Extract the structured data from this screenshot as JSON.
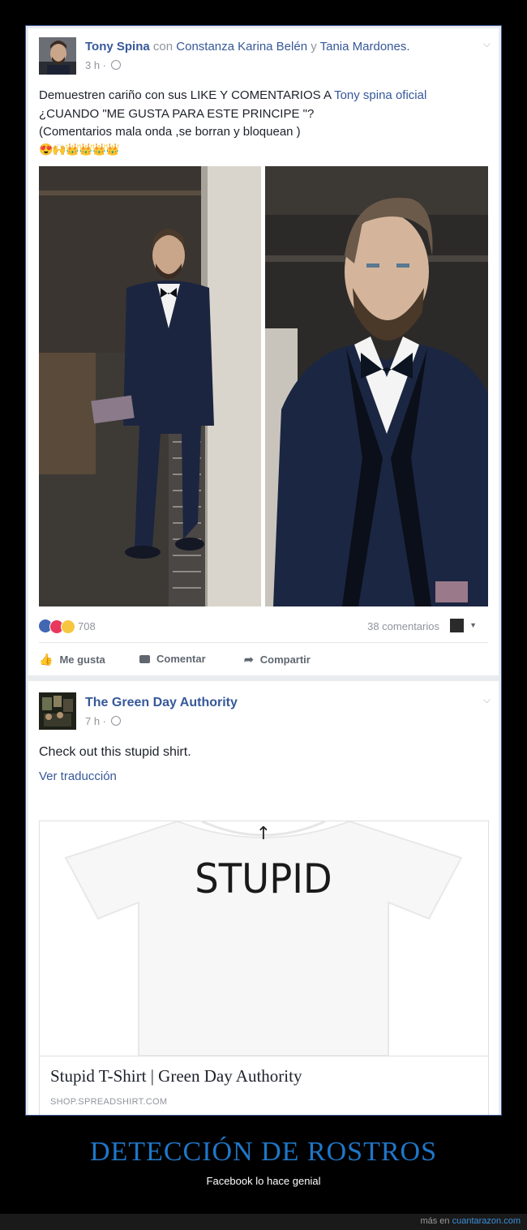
{
  "post1": {
    "author": "Tony Spina",
    "with_word": "con",
    "tag1": "Constanza Karina Belén",
    "and_word": "y",
    "tag2": "Tania Mardones.",
    "time": "3 h ·",
    "line1_prefix": "Demuestren cariño con sus LIKE Y COMENTARIOS A",
    "line1_link": "Tony spina oficial",
    "line2": "¿CUANDO \"ME GUSTA PARA ESTE PRINCIPE \"?",
    "line3": "(Comentarios mala onda ,se borran y bloquean )",
    "emoji": "😍🙌👑👑👑👑",
    "reaction_count": "708",
    "comments": "38 comentarios",
    "like_label": "Me gusta",
    "comment_label": "Comentar",
    "share_label": "Compartir"
  },
  "post2": {
    "author": "The Green Day Authority",
    "time": "7 h ·",
    "text": "Check out this stupid shirt.",
    "translate": "Ver traducción",
    "shirt_word": "STUPID",
    "shirt_arrow": "↑",
    "card_title": "Stupid T-Shirt | Green Day Authority",
    "card_domain": "SHOP.SPREADSHIRT.COM"
  },
  "footer": {
    "title": "DETECCIÓN DE ROSTROS",
    "subtitle": "Facebook lo hace genial",
    "credit_prefix": "más en",
    "credit_site": "cuantarazon.com"
  }
}
